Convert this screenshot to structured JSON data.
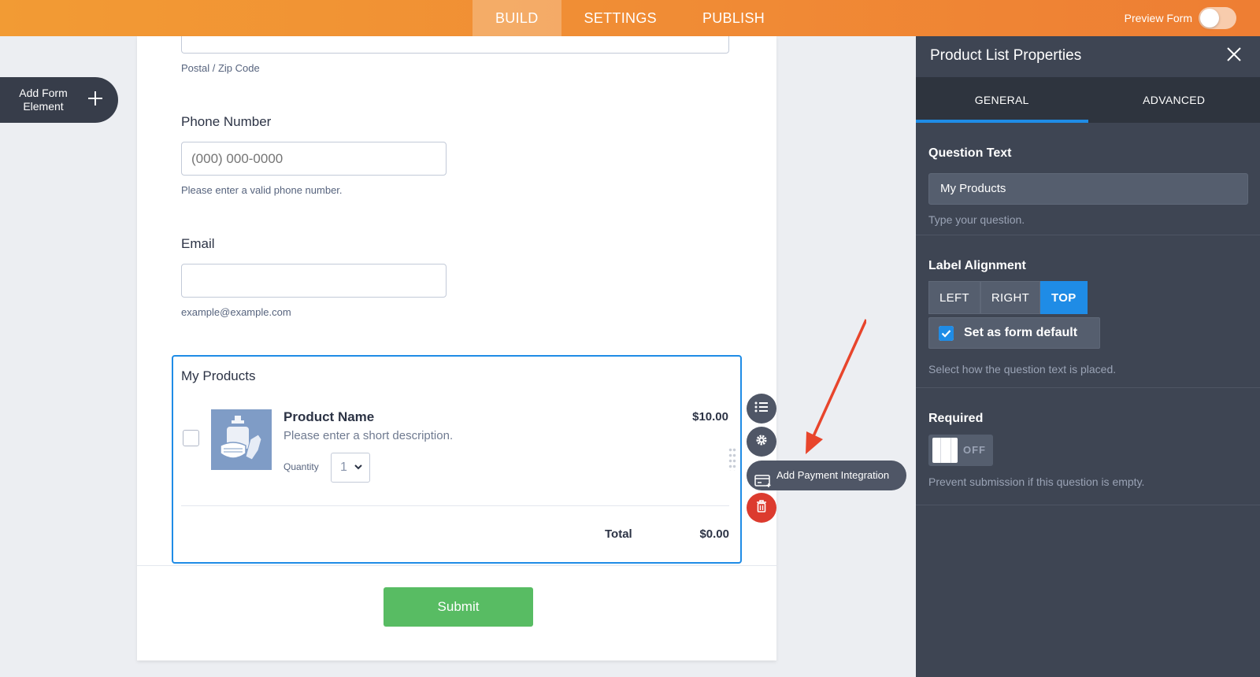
{
  "topbar": {
    "tabs": [
      "BUILD",
      "SETTINGS",
      "PUBLISH"
    ],
    "active_tab": "BUILD",
    "preview_label": "Preview Form",
    "accent": "#f08a35"
  },
  "sidebar": {
    "add_element_label": "Add Form Element"
  },
  "form": {
    "zip_sublabel": "Postal / Zip Code",
    "phone": {
      "label": "Phone Number",
      "placeholder": "(000) 000-0000",
      "sublabel": "Please enter a valid phone number."
    },
    "email": {
      "label": "Email",
      "placeholder": "",
      "sublabel": "example@example.com"
    },
    "products": {
      "title": "My Products",
      "items": [
        {
          "name": "Product Name",
          "description": "Please enter a short description.",
          "price": "$10.00",
          "quantity_label": "Quantity",
          "quantity": "1"
        }
      ],
      "total_label": "Total",
      "total_value": "$0.00"
    },
    "submit_label": "Submit",
    "submit_color": "#58bc63"
  },
  "floating_actions": {
    "tooltip": "Add Payment Integration"
  },
  "panel": {
    "title": "Product List Properties",
    "tabs": [
      "GENERAL",
      "ADVANCED"
    ],
    "active_tab": "GENERAL",
    "question_text": {
      "label": "Question Text",
      "value": "My Products",
      "hint": "Type your question."
    },
    "label_alignment": {
      "label": "Label Alignment",
      "options": [
        "LEFT",
        "RIGHT",
        "TOP"
      ],
      "selected": "TOP",
      "default_checkbox": "Set as form default",
      "default_checked": true,
      "hint": "Select how the question text is placed."
    },
    "required": {
      "label": "Required",
      "state": "OFF",
      "hint": "Prevent submission if this question is empty."
    },
    "accent": "#1f8ce6"
  }
}
